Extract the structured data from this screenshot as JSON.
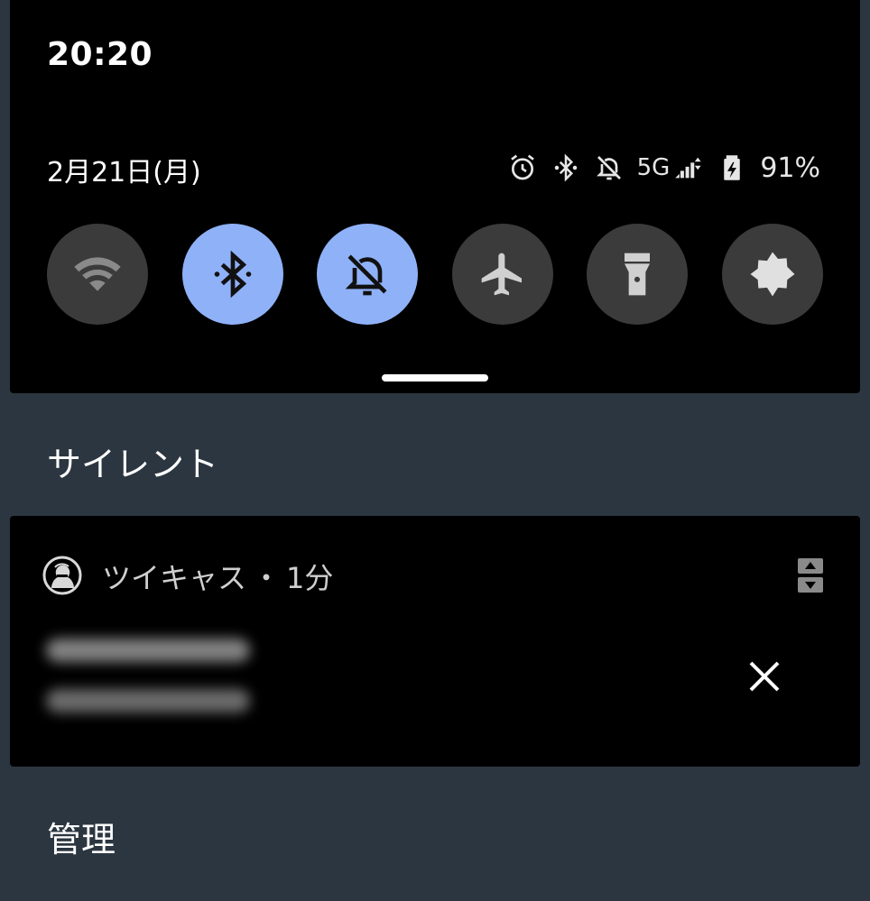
{
  "status_bar": {
    "time": "20:20",
    "date": "2月21日(月)",
    "icons": [
      "alarm-icon",
      "bluetooth-icon",
      "notifications-off-icon",
      "signal-icon",
      "battery-charging-icon"
    ],
    "network": "5G",
    "battery": "91%"
  },
  "quick_settings": {
    "tiles": [
      {
        "name": "wifi",
        "icon": "wifi-icon",
        "active": false
      },
      {
        "name": "bluetooth",
        "icon": "bluetooth-icon",
        "active": true
      },
      {
        "name": "silent",
        "icon": "notifications-off-icon",
        "active": true
      },
      {
        "name": "airplane",
        "icon": "airplane-icon",
        "active": false
      },
      {
        "name": "flashlight",
        "icon": "flashlight-icon",
        "active": false
      },
      {
        "name": "dark-theme",
        "icon": "dark-theme-icon",
        "active": false
      }
    ],
    "colors": {
      "active": "#8fb1f8",
      "inactive": "#3b3b3b"
    }
  },
  "sections": {
    "silent_title": "サイレント",
    "manage_title": "管理"
  },
  "notification": {
    "app_name": "ツイキャス",
    "separator": "・",
    "time_ago": "1分"
  }
}
